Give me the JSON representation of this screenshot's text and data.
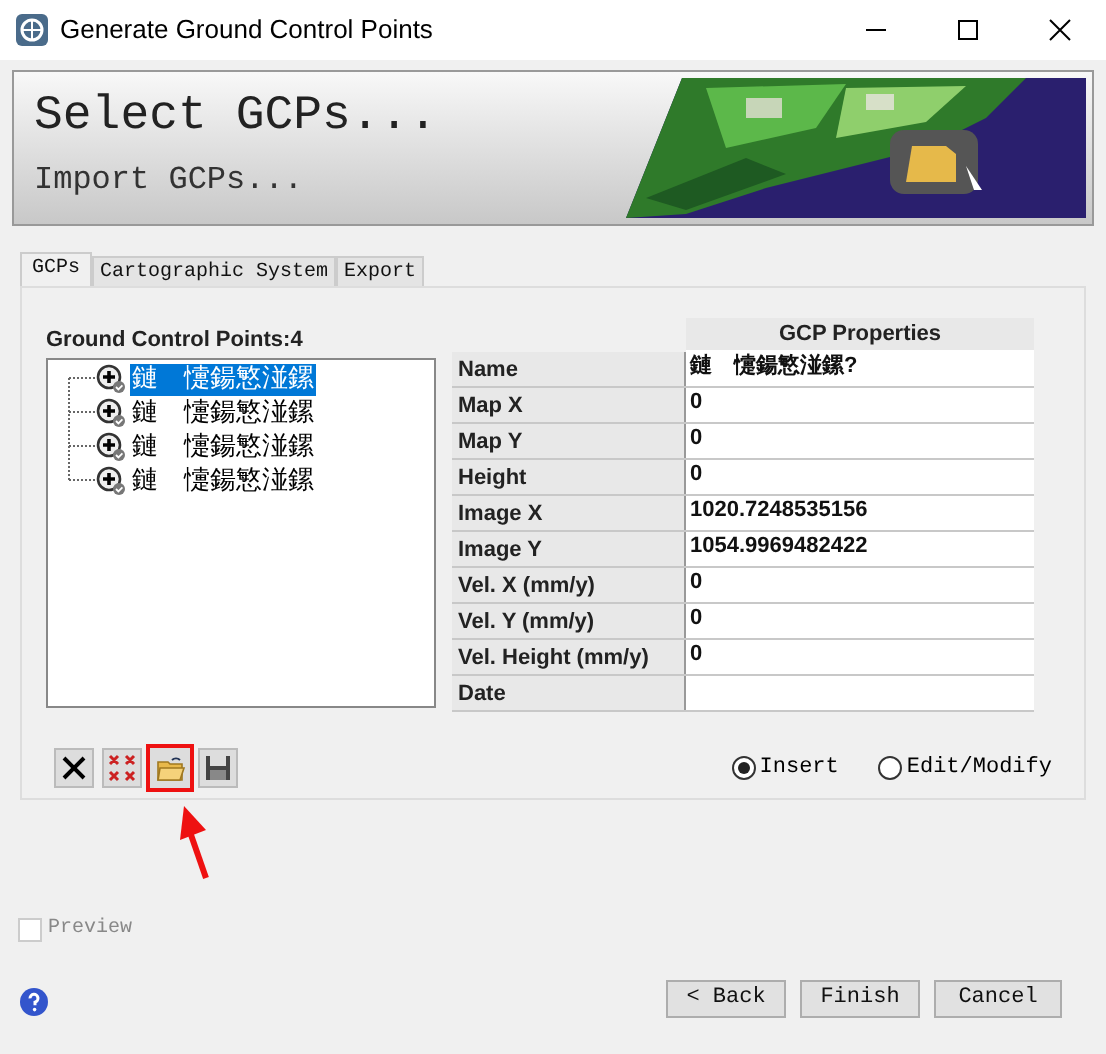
{
  "window": {
    "title": "Generate Ground Control Points"
  },
  "header": {
    "title": "Select GCPs...",
    "subtitle": "Import GCPs..."
  },
  "tabs": [
    {
      "label": "GCPs",
      "selected": true
    },
    {
      "label": "Cartographic System",
      "selected": false
    },
    {
      "label": "Export",
      "selected": false
    }
  ],
  "gcp_list": {
    "label": "Ground Control Points:",
    "count": "4",
    "items": [
      {
        "label": "鏈　懥鍚慜湴鏍",
        "selected": true
      },
      {
        "label": "鏈　懥鍚慜湴鏍",
        "selected": false
      },
      {
        "label": "鏈　懥鍚慜湴鏍",
        "selected": false
      },
      {
        "label": "鏈　懥鍚慜湴鏍",
        "selected": false
      }
    ]
  },
  "properties": {
    "title": "GCP Properties",
    "rows": [
      {
        "label": "Name",
        "value": "鏈　懥鍚慜湴鏍?"
      },
      {
        "label": "Map X",
        "value": "0"
      },
      {
        "label": "Map Y",
        "value": "0"
      },
      {
        "label": "Height",
        "value": "0"
      },
      {
        "label": "Image X",
        "value": "1020.7248535156"
      },
      {
        "label": "Image Y",
        "value": "1054.9969482422"
      },
      {
        "label": "Vel. X (mm/y)",
        "value": "0"
      },
      {
        "label": "Vel. Y (mm/y)",
        "value": "0"
      },
      {
        "label": "Vel. Height (mm/y)",
        "value": "0"
      },
      {
        "label": "Date"
      }
    ]
  },
  "toolbar": [
    {
      "kind": "delete",
      "highlighted": false
    },
    {
      "kind": "delete_all",
      "highlighted": false
    },
    {
      "kind": "import",
      "highlighted": true
    },
    {
      "kind": "save",
      "highlighted": false
    }
  ],
  "mode": [
    {
      "label": "Insert",
      "selected": true
    },
    {
      "label": "Edit/Modify",
      "selected": false
    }
  ],
  "preview": {
    "label": "Preview",
    "checked": false
  },
  "buttons": [
    {
      "label": "< Back"
    },
    {
      "label": "Finish"
    },
    {
      "label": "Cancel"
    }
  ]
}
